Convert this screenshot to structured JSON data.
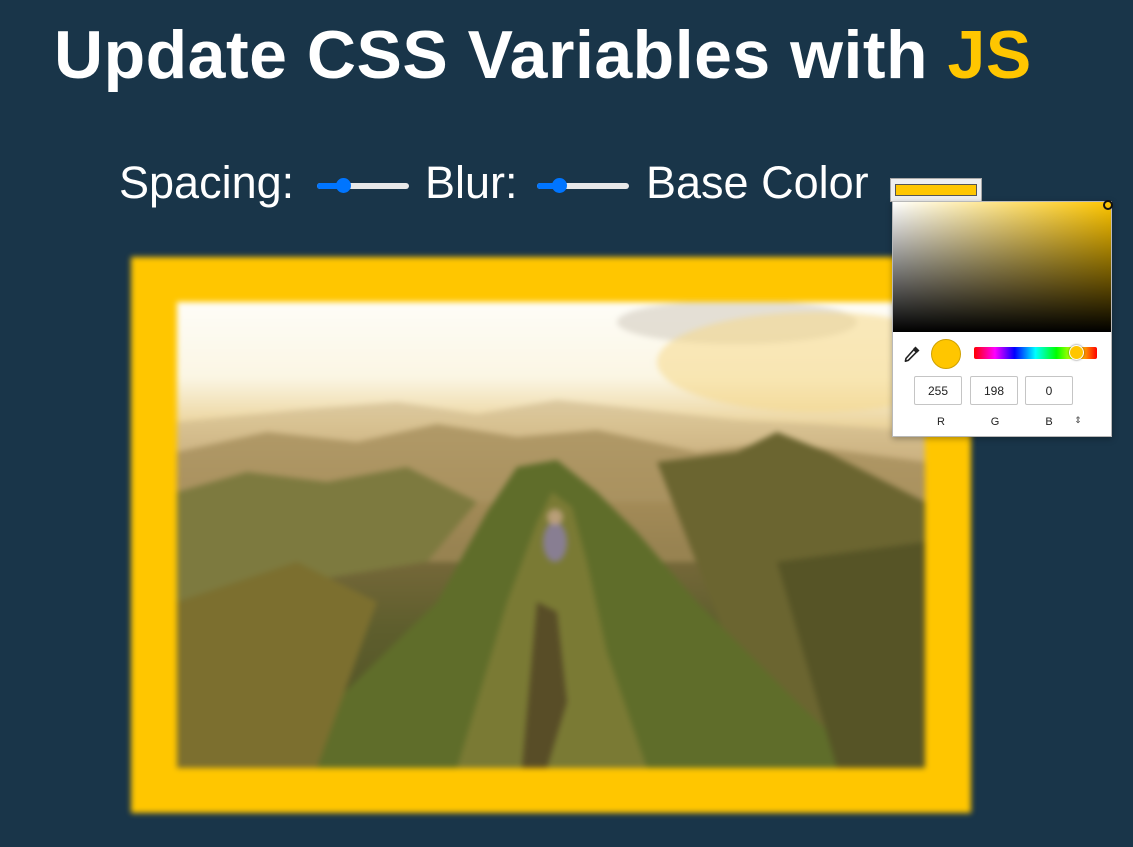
{
  "header": {
    "title_main": "Update CSS Variables with",
    "title_highlight": "JS"
  },
  "controls": {
    "spacing_label": "Spacing:",
    "spacing_value": 0.25,
    "blur_label": "Blur:",
    "blur_value": 0.2,
    "base_color_label": "Base Color"
  },
  "colors": {
    "background": "#193549",
    "accent": "#ffc600",
    "slider_accent": "#0075ff"
  },
  "photo": {
    "subject": "sunlit mountain ridge with hiker",
    "icon": "photo"
  },
  "color_picker": {
    "r": "255",
    "g": "198",
    "b": "0",
    "r_label": "R",
    "g_label": "G",
    "b_label": "B",
    "mode_toggle_icon": "⇕",
    "eyedropper_icon": "eyedropper-icon",
    "hue_position": 0.83
  }
}
